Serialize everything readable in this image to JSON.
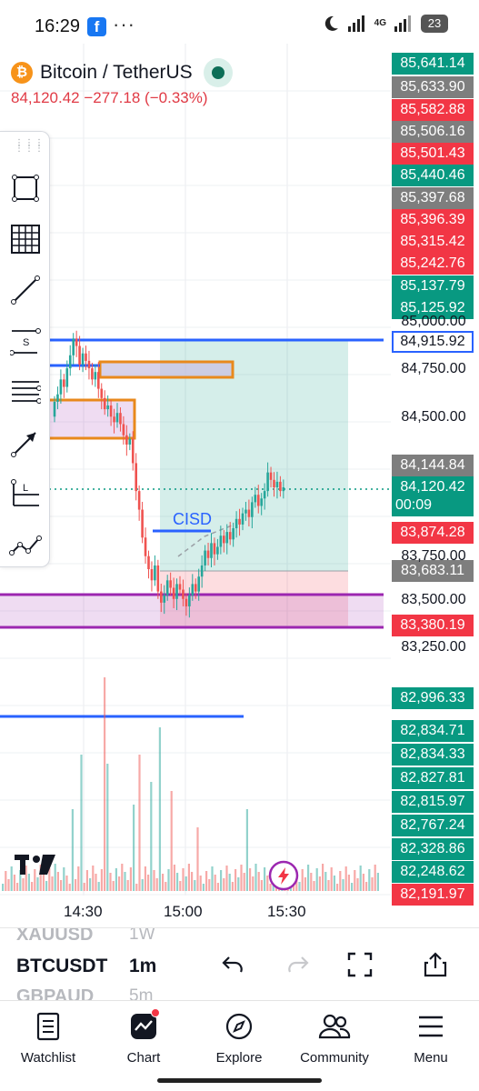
{
  "status_bar": {
    "time": "16:29",
    "notification_icon": "facebook-icon",
    "more": "···",
    "network": "4G",
    "battery": "23"
  },
  "symbol": {
    "name": "Bitcoin / TetherUS",
    "last_price": "84,120.42",
    "change": "−277.18",
    "change_pct": "(−0.33%)",
    "status_color": "#0d6e57"
  },
  "chart": {
    "annotation": "CISD",
    "watermark": "TV"
  },
  "price_axis": {
    "levels": [
      "85,000.00",
      "84,750.00",
      "84,500.00",
      "83,750.00",
      "83,500.00",
      "83,250.00"
    ],
    "tags": [
      {
        "value": "85,641.14",
        "color": "green"
      },
      {
        "value": "85,633.90",
        "color": "gray"
      },
      {
        "value": "85,582.88",
        "color": "red"
      },
      {
        "value": "85,506.16",
        "color": "gray"
      },
      {
        "value": "85,501.43",
        "color": "red"
      },
      {
        "value": "85,440.46",
        "color": "green"
      },
      {
        "value": "85,397.68",
        "color": "gray"
      },
      {
        "value": "85,396.39",
        "color": "red"
      },
      {
        "value": "85,315.42",
        "color": "red"
      },
      {
        "value": "85,242.76",
        "color": "red"
      },
      {
        "value": "85,137.79",
        "color": "green"
      },
      {
        "value": "85,125.92",
        "color": "green"
      },
      {
        "value": "84,915.92",
        "color": "blue"
      },
      {
        "value": "84,144.84",
        "color": "gray"
      },
      {
        "value": "83,874.28",
        "color": "red"
      },
      {
        "value": "83,683.11",
        "color": "gray"
      },
      {
        "value": "83,380.19",
        "color": "red"
      },
      {
        "value": "82,996.33",
        "color": "green"
      },
      {
        "value": "82,834.71",
        "color": "green"
      },
      {
        "value": "82,834.33",
        "color": "green"
      },
      {
        "value": "82,827.81",
        "color": "green"
      },
      {
        "value": "82,815.97",
        "color": "green"
      },
      {
        "value": "82,767.24",
        "color": "green"
      },
      {
        "value": "82,328.86",
        "color": "green"
      },
      {
        "value": "82,248.62",
        "color": "green"
      },
      {
        "value": "82,191.97",
        "color": "red"
      }
    ],
    "current": {
      "price": "84,120.42",
      "countdown": "00:09"
    }
  },
  "time_axis": [
    "14:30",
    "15:00",
    "15:30"
  ],
  "bottom_bar": {
    "symbols": [
      "XAUUSD",
      "BTCUSDT",
      "GBPAUD"
    ],
    "timeframes": [
      "1W",
      "1m",
      "5m"
    ],
    "actions": [
      "undo-icon",
      "redo-icon",
      "fullscreen-icon",
      "share-icon"
    ]
  },
  "nav": [
    {
      "label": "Watchlist",
      "icon": "watchlist-icon"
    },
    {
      "label": "Chart",
      "icon": "chart-icon"
    },
    {
      "label": "Explore",
      "icon": "compass-icon"
    },
    {
      "label": "Community",
      "icon": "community-icon"
    },
    {
      "label": "Menu",
      "icon": "menu-icon"
    }
  ],
  "colors": {
    "up": "#26a69a",
    "down": "#ef5350",
    "red_tag": "#f23645",
    "green_tag": "#089981",
    "gray_tag": "#7e7e7e",
    "blue_line": "#2962ff",
    "purple_zone": "#9c27b0",
    "orange_box": "#e8891c"
  }
}
